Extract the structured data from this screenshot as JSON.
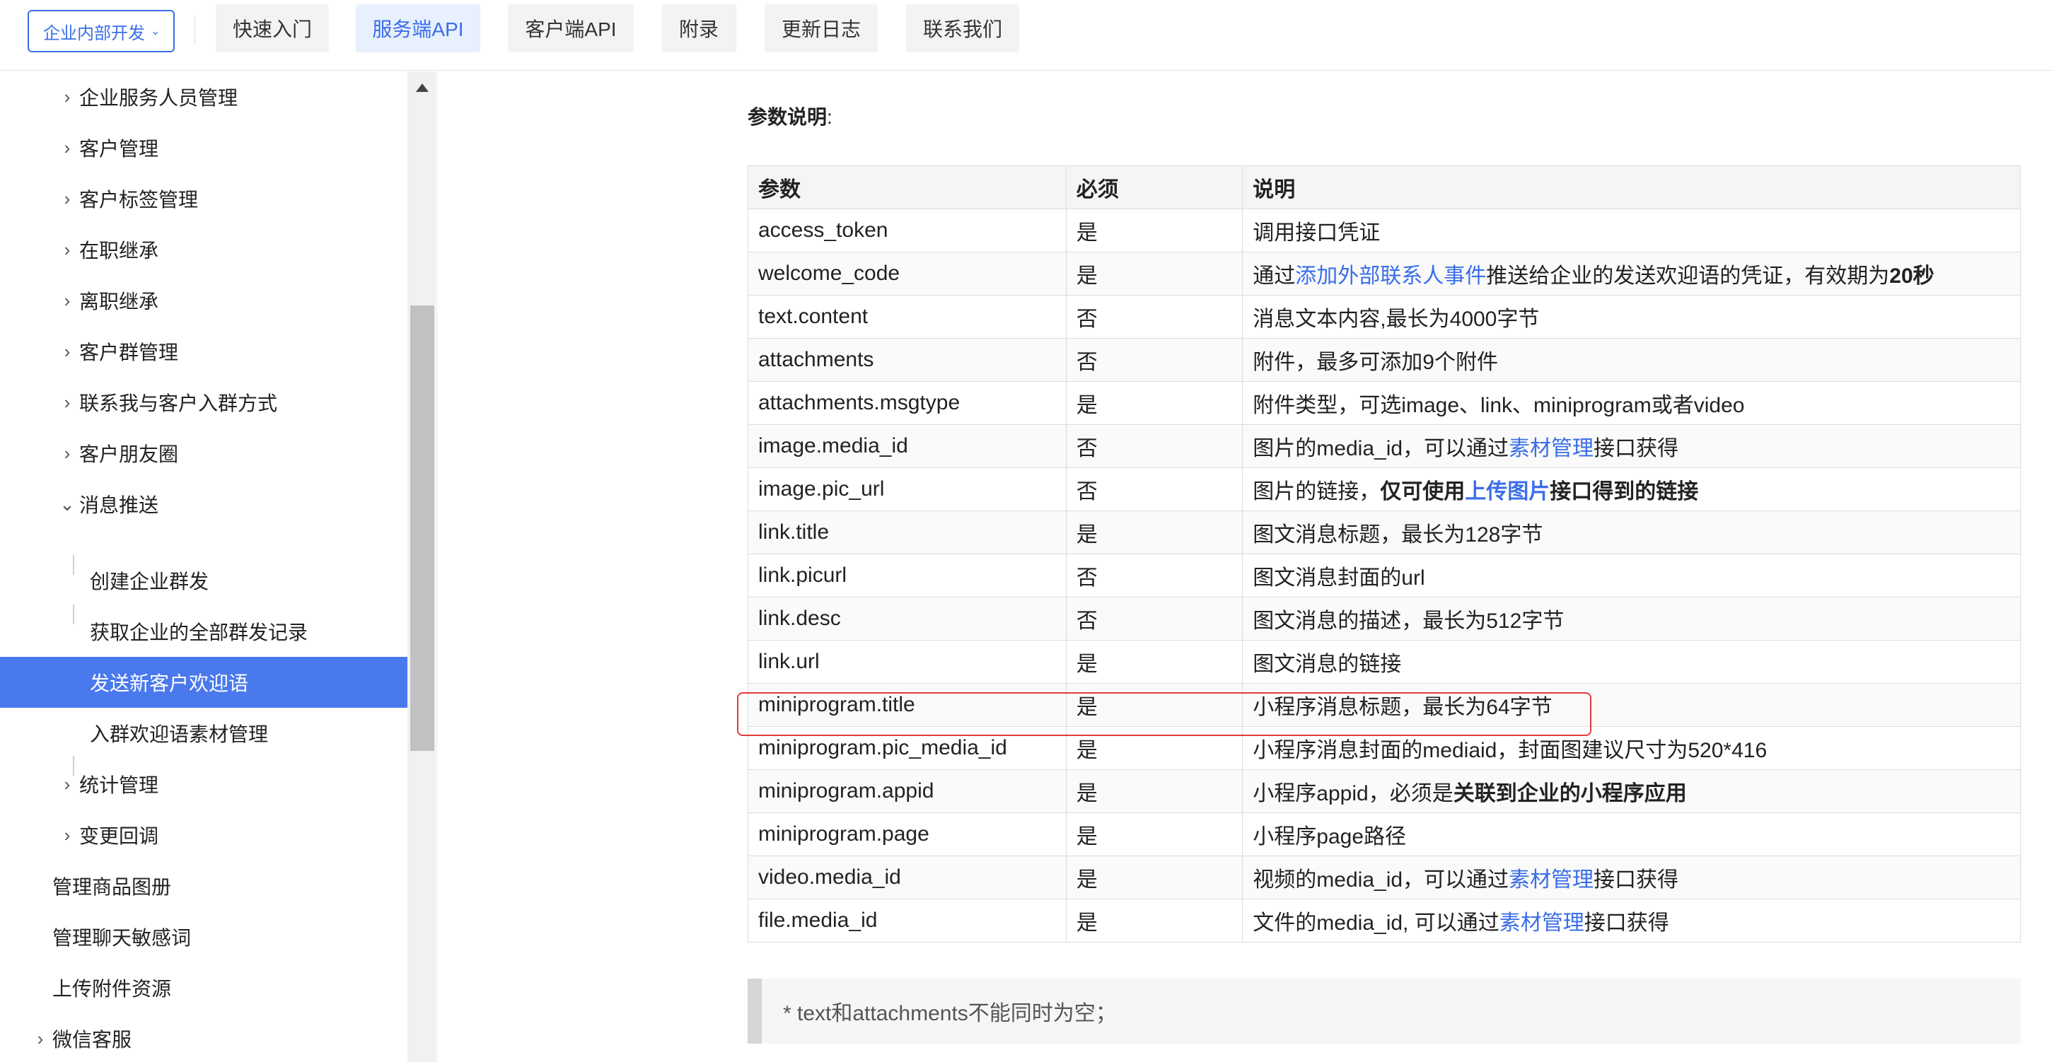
{
  "topnav": {
    "org_select": "企业内部开发",
    "tabs": [
      {
        "label": "快速入门",
        "active": false
      },
      {
        "label": "服务端API",
        "active": true
      },
      {
        "label": "客户端API",
        "active": false
      },
      {
        "label": "附录",
        "active": false
      },
      {
        "label": "更新日志",
        "active": false
      },
      {
        "label": "联系我们",
        "active": false
      }
    ]
  },
  "sidebar": {
    "items": [
      {
        "label": "企业服务人员管理",
        "expanded": false
      },
      {
        "label": "客户管理",
        "expanded": false
      },
      {
        "label": "客户标签管理",
        "expanded": false
      },
      {
        "label": "在职继承",
        "expanded": false
      },
      {
        "label": "离职继承",
        "expanded": false
      },
      {
        "label": "客户群管理",
        "expanded": false
      },
      {
        "label": "联系我与客户入群方式",
        "expanded": false
      },
      {
        "label": "客户朋友圈",
        "expanded": false
      },
      {
        "label": "消息推送",
        "expanded": true
      }
    ],
    "sub_items": [
      {
        "label": "创建企业群发",
        "active": false
      },
      {
        "label": "获取企业的全部群发记录",
        "active": false
      },
      {
        "label": "发送新客户欢迎语",
        "active": true
      },
      {
        "label": "入群欢迎语素材管理",
        "active": false
      }
    ],
    "items_after": [
      {
        "label": "统计管理",
        "expanded": false
      },
      {
        "label": "变更回调",
        "expanded": false
      }
    ],
    "top_level": [
      {
        "label": "管理商品图册"
      },
      {
        "label": "管理聊天敏感词"
      },
      {
        "label": "上传附件资源"
      },
      {
        "label": "微信客服",
        "expandable": true
      }
    ],
    "active_color": "#4a79ee"
  },
  "content": {
    "heading_bold": "参数说明",
    "heading_suffix": ":",
    "table": {
      "headers": [
        "参数",
        "必须",
        "说明"
      ],
      "rows": [
        {
          "param": "access_token",
          "required": "是",
          "desc": [
            {
              "t": "调用接口凭证"
            }
          ]
        },
        {
          "param": "welcome_code",
          "required": "是",
          "desc": [
            {
              "t": "通过"
            },
            {
              "t": "添加外部联系人事件",
              "link": true
            },
            {
              "t": "推送给企业的发送欢迎语的凭证，有效期为"
            },
            {
              "t": "20秒",
              "bold": true
            }
          ]
        },
        {
          "param": "text.content",
          "required": "否",
          "desc": [
            {
              "t": "消息文本内容,最长为4000字节"
            }
          ]
        },
        {
          "param": "attachments",
          "required": "否",
          "desc": [
            {
              "t": "附件，最多可添加9个附件"
            }
          ]
        },
        {
          "param": "attachments.msgtype",
          "required": "是",
          "desc": [
            {
              "t": "附件类型，可选image、link、miniprogram或者video"
            }
          ]
        },
        {
          "param": "image.media_id",
          "required": "否",
          "desc": [
            {
              "t": "图片的media_id，可以通过"
            },
            {
              "t": "素材管理",
              "link": true
            },
            {
              "t": "接口获得"
            }
          ]
        },
        {
          "param": "image.pic_url",
          "required": "否",
          "desc": [
            {
              "t": "图片的链接，"
            },
            {
              "t": "仅可使用",
              "bold": true
            },
            {
              "t": "上传图片",
              "link": true,
              "bold": true
            },
            {
              "t": "接口得到的链接",
              "bold": true
            }
          ]
        },
        {
          "param": "link.title",
          "required": "是",
          "desc": [
            {
              "t": "图文消息标题，最长为128字节"
            }
          ]
        },
        {
          "param": "link.picurl",
          "required": "否",
          "desc": [
            {
              "t": "图文消息封面的url"
            }
          ]
        },
        {
          "param": "link.desc",
          "required": "否",
          "desc": [
            {
              "t": "图文消息的描述，最长为512字节"
            }
          ]
        },
        {
          "param": "link.url",
          "required": "是",
          "desc": [
            {
              "t": "图文消息的链接"
            }
          ]
        },
        {
          "param": "miniprogram.title",
          "required": "是",
          "desc": [
            {
              "t": "小程序消息标题，最长为64字节"
            }
          ],
          "highlighted": true
        },
        {
          "param": "miniprogram.pic_media_id",
          "required": "是",
          "desc": [
            {
              "t": "小程序消息封面的mediaid，封面图建议尺寸为520*416"
            }
          ]
        },
        {
          "param": "miniprogram.appid",
          "required": "是",
          "desc": [
            {
              "t": "小程序appid，必须是"
            },
            {
              "t": "关联到企业的小程序应用",
              "bold": true
            }
          ]
        },
        {
          "param": "miniprogram.page",
          "required": "是",
          "desc": [
            {
              "t": "小程序page路径"
            }
          ]
        },
        {
          "param": "video.media_id",
          "required": "是",
          "desc": [
            {
              "t": "视频的media_id，可以通过"
            },
            {
              "t": "素材管理",
              "link": true
            },
            {
              "t": "接口获得"
            }
          ]
        },
        {
          "param": "file.media_id",
          "required": "是",
          "desc": [
            {
              "t": "文件的media_id, 可以通过"
            },
            {
              "t": "素材管理",
              "link": true
            },
            {
              "t": "接口获得"
            }
          ]
        }
      ]
    },
    "note": "* text和attachments不能同时为空；"
  },
  "colors": {
    "accent": "#3a6ee8",
    "highlight": "#e03c3c"
  }
}
